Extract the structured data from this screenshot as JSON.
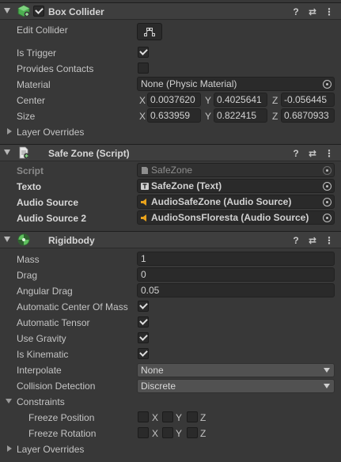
{
  "box_collider": {
    "title": "Box Collider",
    "enabled": true,
    "edit_collider_label": "Edit Collider",
    "is_trigger_label": "Is Trigger",
    "is_trigger": true,
    "provides_contacts_label": "Provides Contacts",
    "provides_contacts": false,
    "material_label": "Material",
    "material_value": "None (Physic Material)",
    "center_label": "Center",
    "center": {
      "x_label": "X",
      "x": "0.0037620",
      "y_label": "Y",
      "y": "0.4025641",
      "z_label": "Z",
      "z": "-0.056445"
    },
    "size_label": "Size",
    "size": {
      "x_label": "X",
      "x": "0.633959",
      "y_label": "Y",
      "y": "0.822415",
      "z_label": "Z",
      "z": "0.6870933"
    },
    "layer_overrides_label": "Layer Overrides"
  },
  "safe_zone": {
    "title": "Safe Zone (Script)",
    "script_label": "Script",
    "script_value": "SafeZone",
    "texto_label": "Texto",
    "texto_value": "SafeZone (Text)",
    "audio_source_label": "Audio Source",
    "audio_source_value": "AudioSafeZone (Audio Source)",
    "audio_source2_label": "Audio Source 2",
    "audio_source2_value": "AudioSonsFloresta (Audio Source)"
  },
  "rigidbody": {
    "title": "Rigidbody",
    "mass_label": "Mass",
    "mass": "1",
    "drag_label": "Drag",
    "drag": "0",
    "angular_drag_label": "Angular Drag",
    "angular_drag": "0.05",
    "auto_com_label": "Automatic Center Of Mass",
    "auto_com": true,
    "auto_tensor_label": "Automatic Tensor",
    "auto_tensor": true,
    "use_gravity_label": "Use Gravity",
    "use_gravity": true,
    "is_kinematic_label": "Is Kinematic",
    "is_kinematic": true,
    "interpolate_label": "Interpolate",
    "interpolate_value": "None",
    "collision_detection_label": "Collision Detection",
    "collision_detection_value": "Discrete",
    "constraints_label": "Constraints",
    "freeze_position_label": "Freeze Position",
    "freeze_rotation_label": "Freeze Rotation",
    "axes": [
      "X",
      "Y",
      "Z"
    ],
    "layer_overrides_label": "Layer Overrides"
  },
  "header_buttons": {
    "help": "?",
    "presets": "⇄",
    "more": "⋮"
  },
  "colors": {
    "panel": "#383838",
    "header": "#3e3e3e",
    "field": "#2a2a2a",
    "audio_icon": "#e8a21c",
    "green_icon": "#4caf50"
  }
}
